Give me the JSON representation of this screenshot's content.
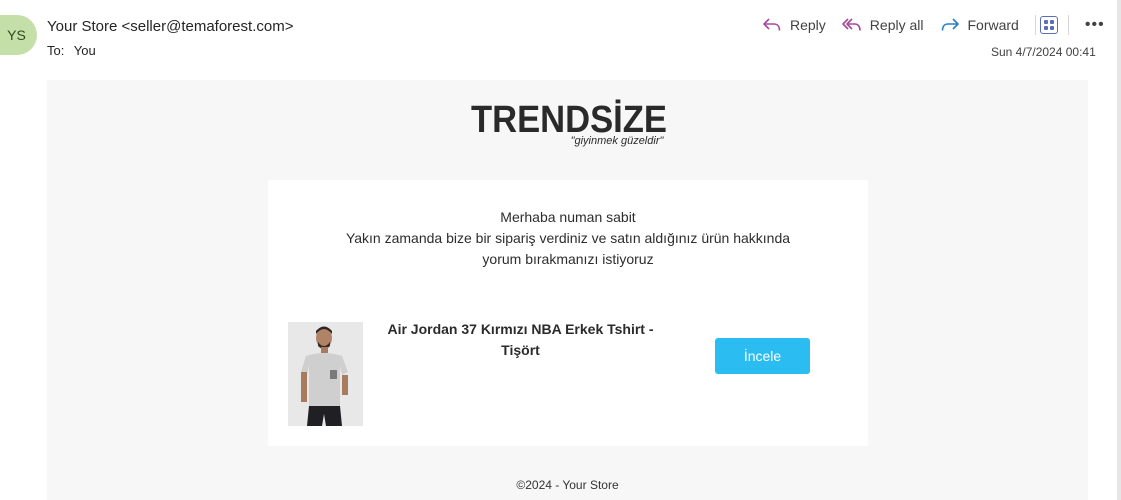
{
  "header": {
    "avatar_initials": "YS",
    "sender": "Your Store <seller@temaforest.com>",
    "to_label": "To:",
    "to_value": "You",
    "timestamp": "Sun 4/7/2024 00:41",
    "actions": {
      "reply": "Reply",
      "reply_all": "Reply all",
      "forward": "Forward"
    },
    "icons": [
      "reply-icon",
      "reply-all-icon",
      "forward-icon",
      "apps-grid-icon",
      "more-icon"
    ],
    "colors": {
      "avatar_bg": "#c5dfa8",
      "reply_icon": "#a64a9c",
      "forward_icon": "#2b7fc4"
    }
  },
  "email": {
    "brand": "TRENDSİZE",
    "slogan": "\"giyinmek güzeldir\"",
    "greeting": "Merhaba numan sabit",
    "message_line1": "Yakın zamanda bize bir sipariş verdiniz ve satın aldığınız ürün hakkında",
    "message_line2": "yorum bırakmanızı istiyoruz",
    "product": {
      "title_line1": "Air Jordan 37 Kırmızı NBA Erkek Tshirt -",
      "title_line2": "Tişört"
    },
    "cta_label": "İncele",
    "footer": "©2024 - Your Store",
    "colors": {
      "cta": "#2bbcf2",
      "background": "#f7f7f7"
    }
  }
}
